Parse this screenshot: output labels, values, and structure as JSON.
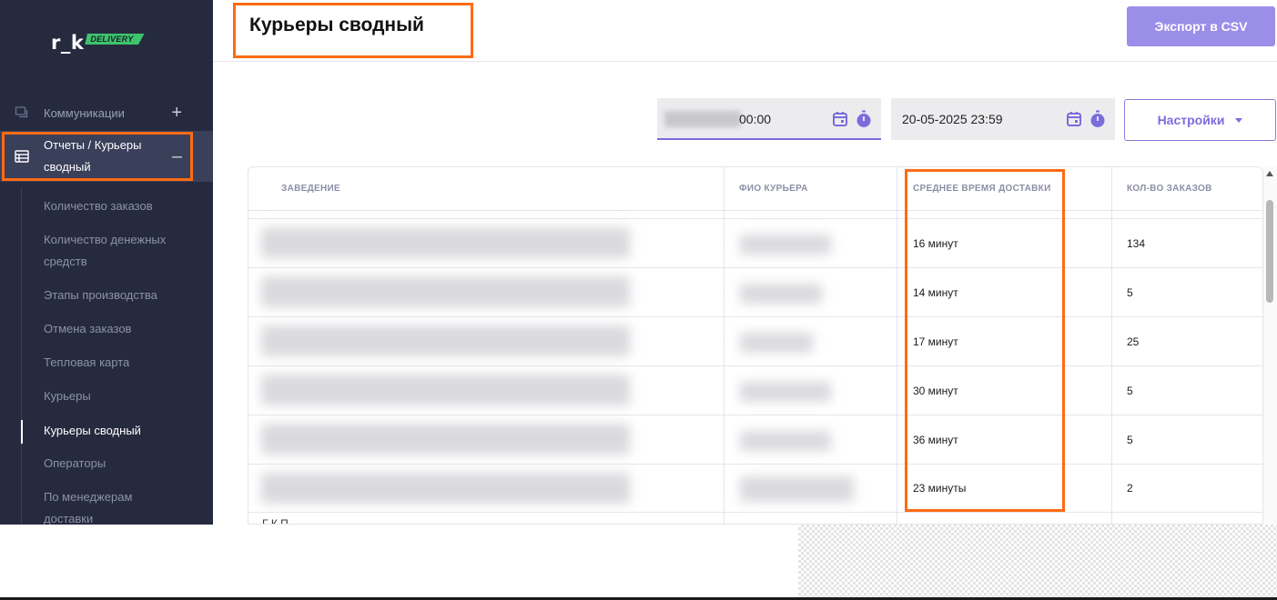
{
  "brand": {
    "logo_text": "r_k",
    "logo_tag": "DELIVERY",
    "tag_color": "#3dc46a"
  },
  "sidebar": {
    "background": "#262a3f",
    "nav": [
      {
        "label": "Коммуникации",
        "icon": "chat-icon",
        "toggle": "+"
      },
      {
        "label": "Отчеты / Курьеры сводный",
        "icon": "table-icon",
        "toggle": "–",
        "active": true
      }
    ],
    "sub_items": [
      {
        "label": "Количество заказов"
      },
      {
        "label": "Количество денежных средств"
      },
      {
        "label": "Этапы производства"
      },
      {
        "label": "Отмена заказов"
      },
      {
        "label": "Тепловая карта"
      },
      {
        "label": "Курьеры"
      },
      {
        "label": "Курьеры сводный",
        "active": true
      },
      {
        "label": "Операторы"
      },
      {
        "label": "По менеджерам доставки"
      }
    ]
  },
  "header": {
    "title": "Курьеры сводный",
    "export_label": "Экспорт в CSV",
    "accent": "#9b8ee8"
  },
  "filters": {
    "date_from": "00:00",
    "date_to": "20-05-2025 23:59",
    "settings_label": "Настройки"
  },
  "table": {
    "headers": [
      "ЗАВЕДЕНИЕ",
      "ФИО КУРЬЕРА",
      "СРЕДНЕЕ ВРЕМЯ ДОСТАВКИ",
      "КОЛ-ВО ЗАКАЗОВ"
    ],
    "rows": [
      {
        "avg_time": "16 минут",
        "orders": "134"
      },
      {
        "avg_time": "14 минут",
        "orders": "5"
      },
      {
        "avg_time": "17 минут",
        "orders": "25"
      },
      {
        "avg_time": "30 минут",
        "orders": "5"
      },
      {
        "avg_time": "36 минут",
        "orders": "5"
      },
      {
        "avg_time": "23 минуты",
        "orders": "2"
      }
    ],
    "partial_row_text": "Г        К     П"
  },
  "annotation_color": "#ff6b14"
}
